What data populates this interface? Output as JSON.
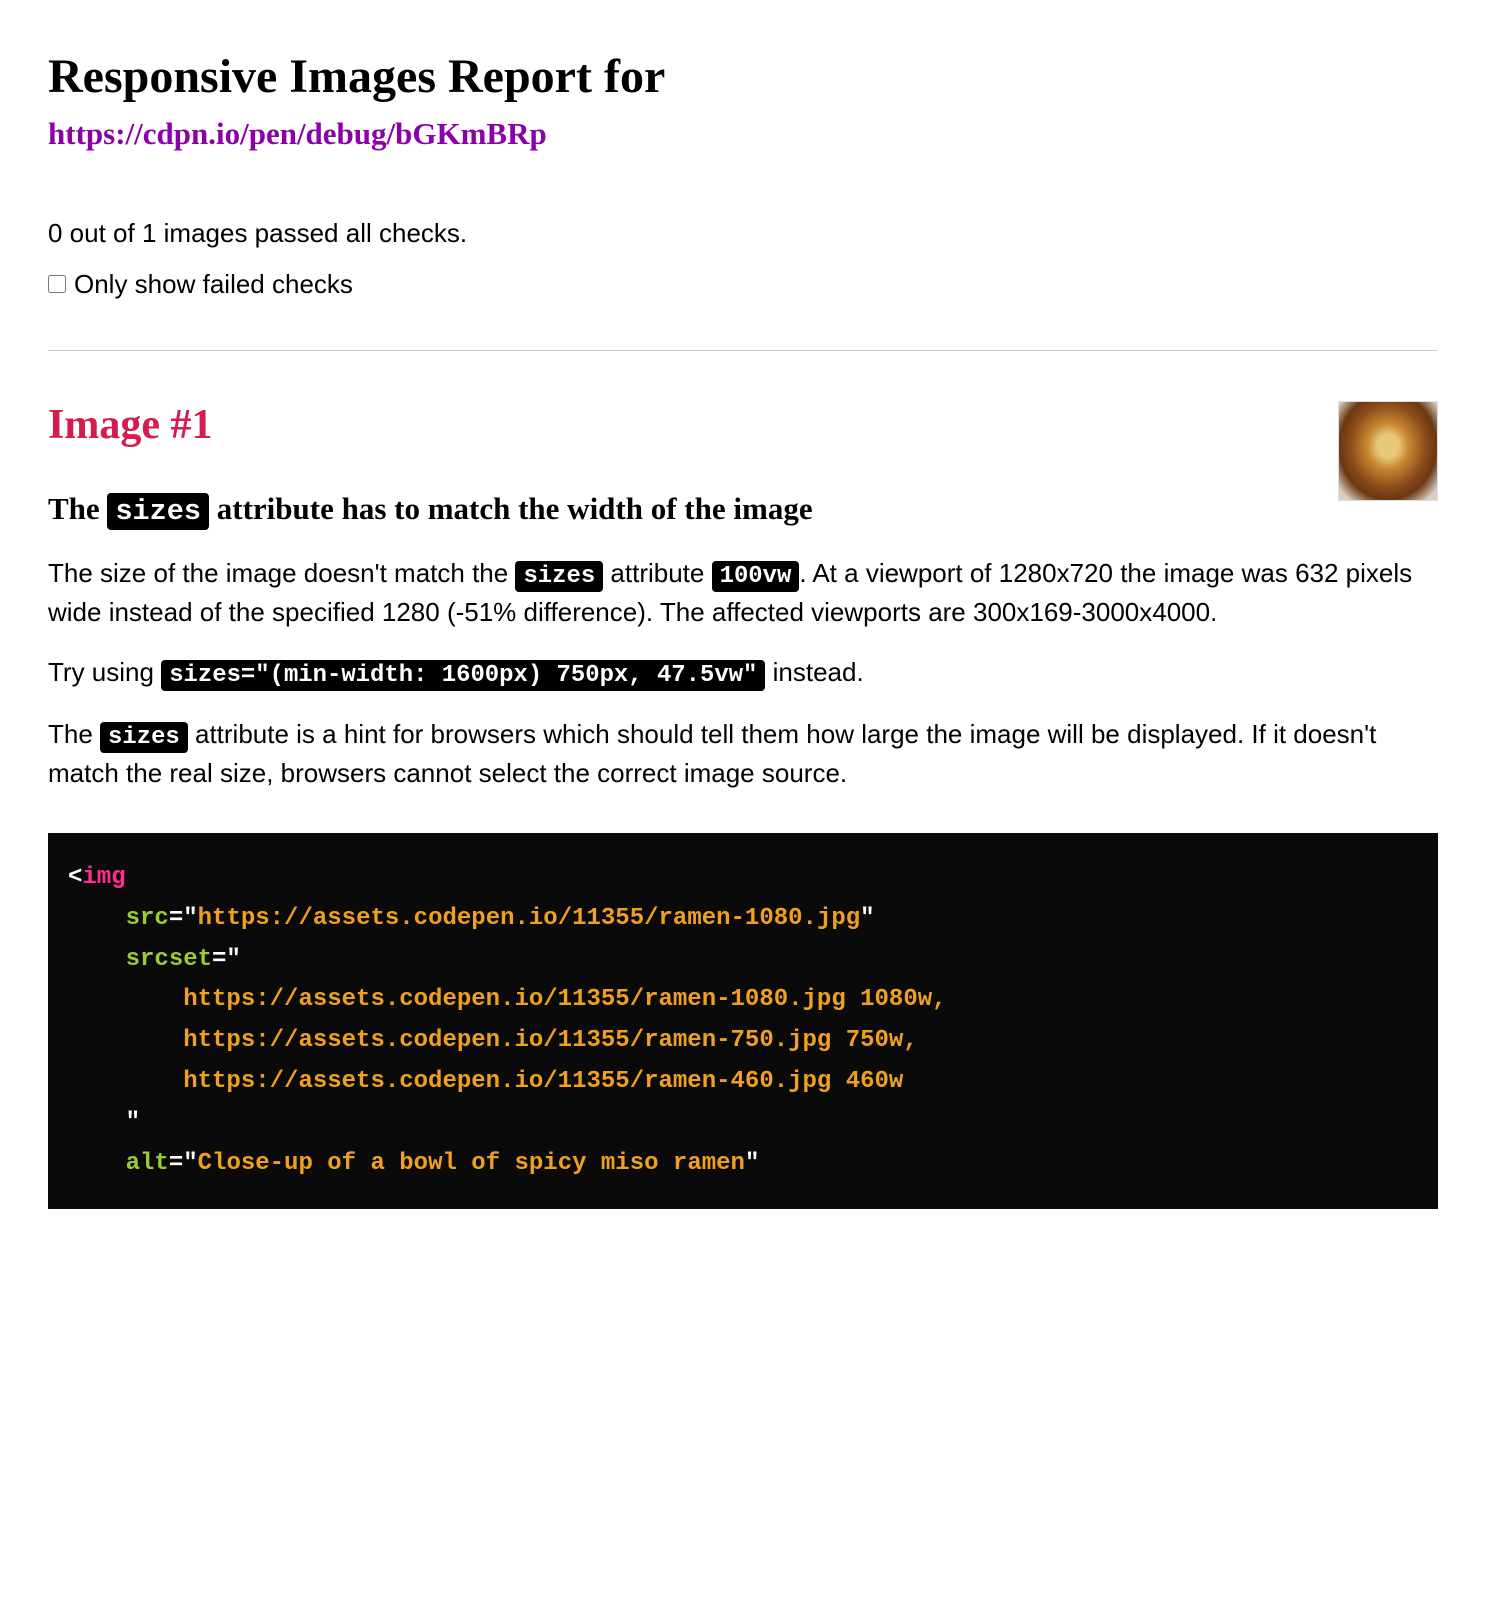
{
  "header": {
    "title": "Responsive Images Report for",
    "url": "https://cdpn.io/pen/debug/bGKmBRp"
  },
  "summary": {
    "text": "0 out of 1 images passed all checks."
  },
  "filter": {
    "label": "Only show failed checks",
    "checked": false
  },
  "image_section": {
    "heading": "Image #1",
    "check_heading_pre": "The ",
    "check_heading_code": "sizes",
    "check_heading_post": " attribute has to match the width of the image",
    "para1": {
      "t1": "The size of the image doesn't match the ",
      "c1": "sizes",
      "t2": " attribute ",
      "c2": "100vw",
      "t3": ". At a viewport of 1280x720 the image was 632 pixels wide instead of the specified 1280 (-51% difference). The affected viewports are 300x169-3000x4000."
    },
    "para2": {
      "t1": "Try using ",
      "c1": "sizes=\"(min-width: 1600px) 750px, 47.5vw\"",
      "t2": " instead."
    },
    "para3": {
      "t1": "The ",
      "c1": "sizes",
      "t2": " attribute is a hint for browsers which should tell them how large the image will be displayed. If it doesn't match the real size, browsers cannot select the correct image source."
    },
    "code": {
      "l1_open": "<",
      "l1_tag": "img",
      "l2_attr": "src",
      "l2_eq": "=\"",
      "l2_val": "https://assets.codepen.io/11355/ramen-1080.jpg",
      "l2_close": "\"",
      "l3_attr": "srcset",
      "l3_eq": "=\"",
      "l4_val": "https://assets.codepen.io/11355/ramen-1080.jpg 1080w,",
      "l5_val": "https://assets.codepen.io/11355/ramen-750.jpg 750w,",
      "l6_val": "https://assets.codepen.io/11355/ramen-460.jpg 460w",
      "l7_close": "\"",
      "l8_attr": "alt",
      "l8_eq": "=\"",
      "l8_val": "Close-up of a bowl of spicy miso ramen",
      "l8_close": "\""
    }
  }
}
